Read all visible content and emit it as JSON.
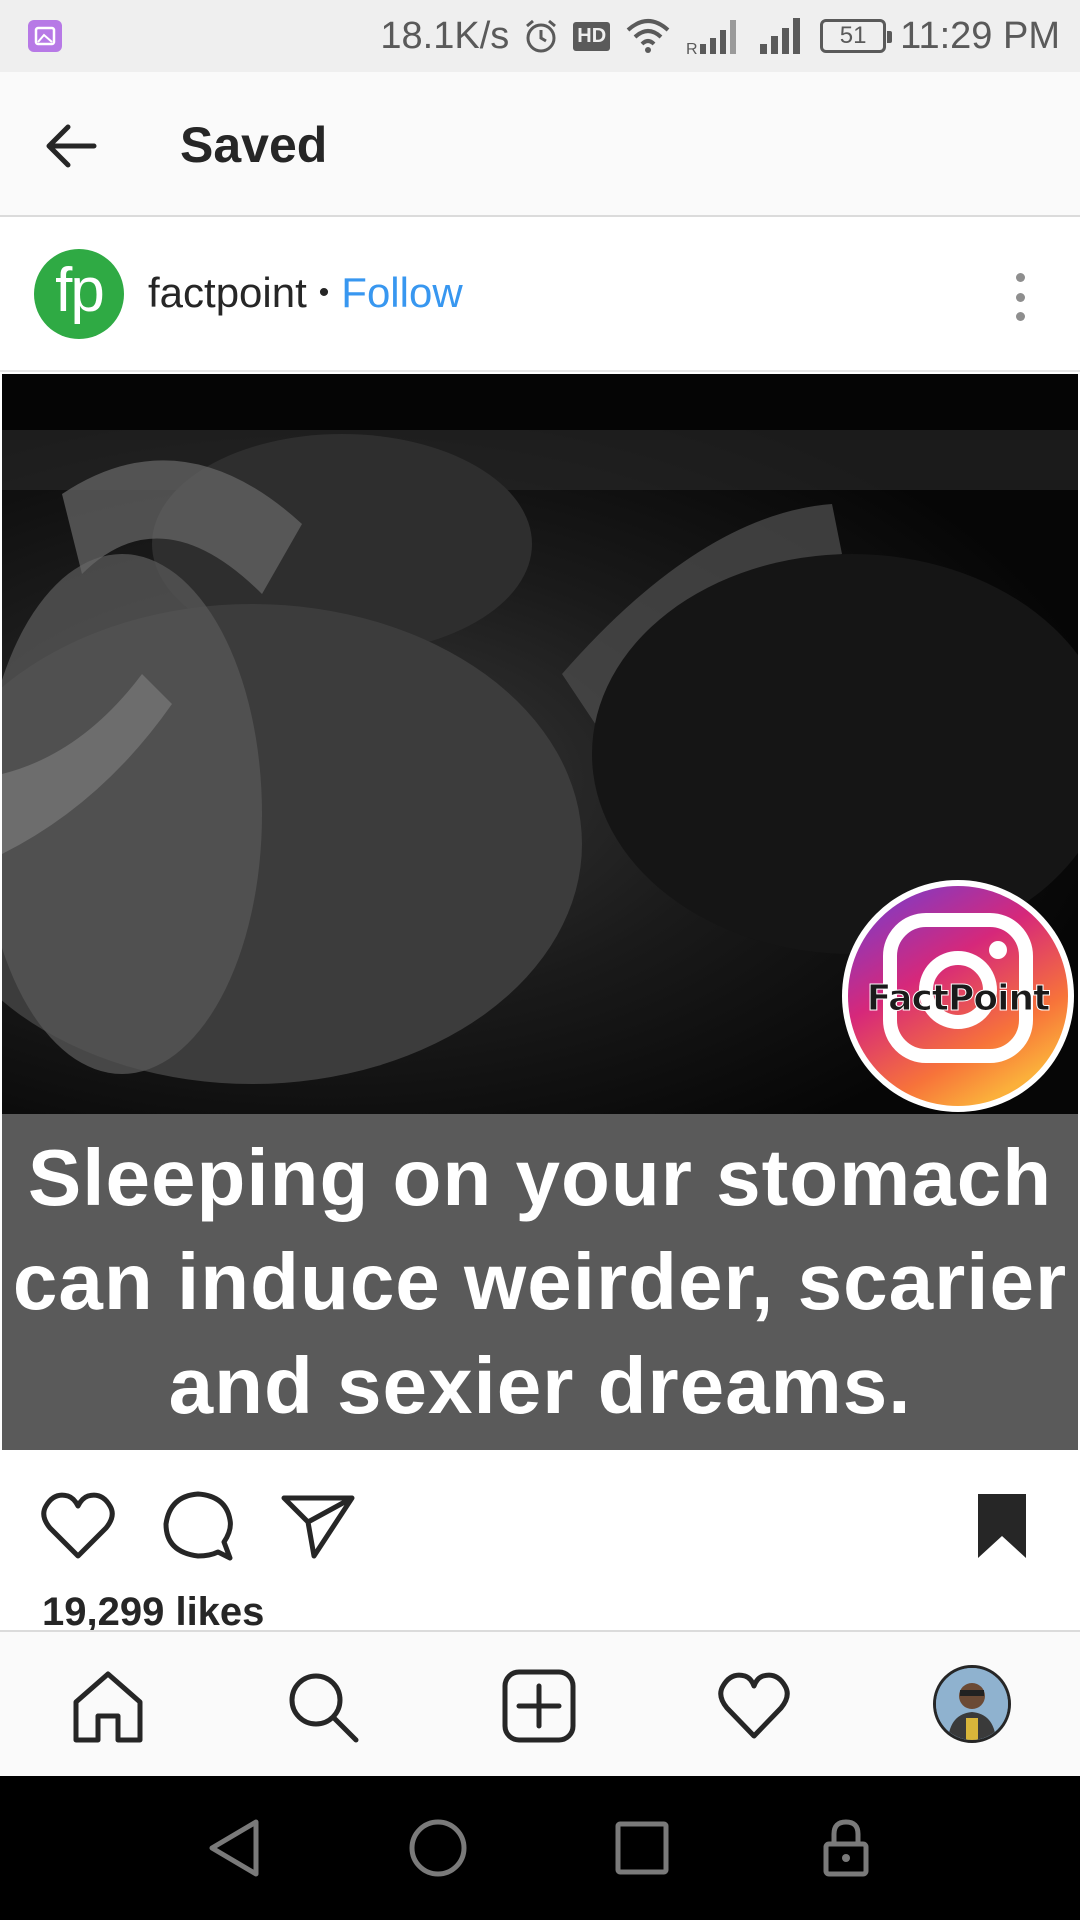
{
  "status_bar": {
    "speed": "18.1K/s",
    "hd": "HD",
    "battery": "51",
    "time": "11:29 PM",
    "icons": [
      "gallery-icon",
      "alarm-icon",
      "wifi-icon",
      "signal-icon",
      "signal-icon",
      "battery-icon"
    ]
  },
  "header": {
    "title": "Saved",
    "back_icon": "arrow-left-icon"
  },
  "post": {
    "avatar_text": "fp",
    "username": "factpoint",
    "separator": "•",
    "follow_label": "Follow",
    "image": {
      "caption_lines": [
        "Sleeping on your stomach",
        "can induce weirder, scarier",
        "and sexier dreams."
      ],
      "logo_text": "FactPoint"
    },
    "likes": "19,299 likes",
    "colors": {
      "follow": "#3897f0",
      "avatar_bg": "#2faa44"
    }
  },
  "actions": {
    "icons": [
      "heart-icon",
      "comment-icon",
      "share-icon",
      "bookmark-icon"
    ]
  },
  "bottom_nav": {
    "icons": [
      "home-icon",
      "search-icon",
      "add-post-icon",
      "activity-heart-icon",
      "profile-avatar"
    ]
  },
  "system_nav": {
    "icons": [
      "back-triangle-icon",
      "home-circle-icon",
      "recents-square-icon",
      "lock-icon"
    ]
  }
}
